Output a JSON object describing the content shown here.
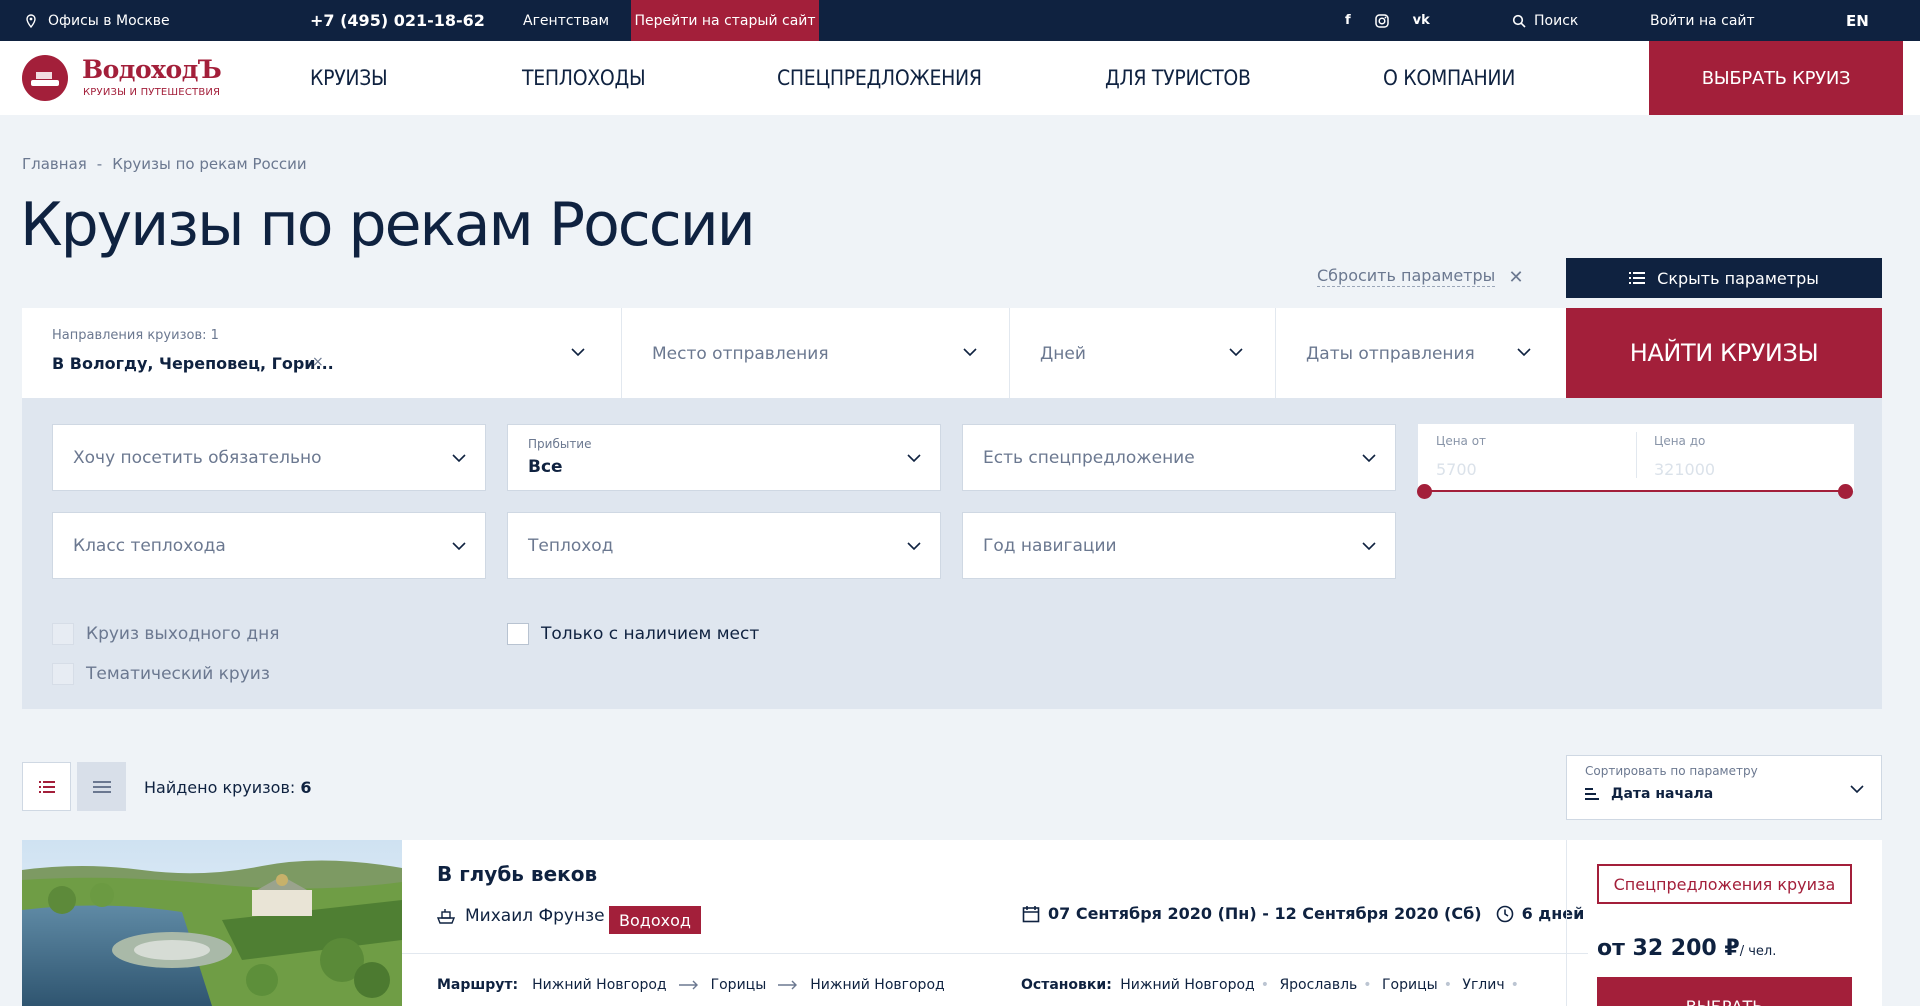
{
  "topbar": {
    "office": "Офисы в Москве",
    "phone": "+7 (495) 021-18-62",
    "agency": "Агентствам",
    "old_site": "Перейти на старый сайт",
    "social": [
      "f",
      "ig",
      "vk"
    ],
    "search": "Поиск",
    "login": "Войти на сайт",
    "lang": "EN"
  },
  "logo": {
    "name": "ВодоходЪ",
    "tagline": "КРУИЗЫ И ПУТЕШЕСТВИЯ"
  },
  "nav": {
    "items": [
      "КРУИЗЫ",
      "ТЕПЛОХОДЫ",
      "СПЕЦПРЕДЛОЖЕНИЯ",
      "ДЛЯ ТУРИСТОВ",
      "О КОМПАНИИ"
    ],
    "cta": "ВЫБРАТЬ КРУИЗ"
  },
  "breadcrumb": {
    "home": "Главная",
    "sep": "-",
    "current": "Круизы по рекам России"
  },
  "page_title": "Круизы по рекам России",
  "controls": {
    "reset": "Сбросить параметры",
    "hide": "Скрыть параметры",
    "find": "НАЙТИ КРУИЗЫ"
  },
  "filters": {
    "directions_label": "Направления круизов: 1",
    "directions_value": "В Вологду, Череповец, Гори...",
    "clear": "×",
    "departure": "Место отправления",
    "days": "Дней",
    "dates": "Даты отправления"
  },
  "extended": {
    "must_visit": "Хочу посетить обязательно",
    "arrival_label": "Прибытие",
    "arrival_value": "Все",
    "special_offer": "Есть спецпредложение",
    "ship_class": "Класс теплохода",
    "ship": "Теплоход",
    "nav_year": "Год навигации",
    "price_from_label": "Цена от",
    "price_from": "5700",
    "price_to_label": "Цена до",
    "price_to": "321000",
    "weekend": "Круиз выходного дня",
    "thematic": "Тематический круиз",
    "available": "Только с наличием мест"
  },
  "results": {
    "found_label": "Найдено круизов:",
    "found_count": "6",
    "sort_label": "Сортировать по параметру",
    "sort_value": "Дата начала"
  },
  "card": {
    "name": "В глубь веков",
    "ship": "Михаил Фрунзе",
    "tag": "Водоход",
    "dates": "07 Сентября 2020 (Пн) - 12 Сентября 2020 (Сб)",
    "days": "6 дней",
    "route_label": "Маршрут:",
    "route": [
      "Нижний Новгород",
      "Горицы",
      "Нижний Новгород"
    ],
    "stops_label": "Остановки:",
    "stops": [
      "Нижний Новгород",
      "Ярославль",
      "Горицы",
      "Углич"
    ],
    "special_button": "Спецпредложения круиза",
    "price": "от 32 200 ₽",
    "price_unit": "/ чел.",
    "choose": "ВЫБРАТЬ"
  },
  "colors": {
    "navy": "#0f2240",
    "accent": "#a31f3a",
    "bg": "#eff3f7",
    "panel": "#dfe6ef"
  }
}
